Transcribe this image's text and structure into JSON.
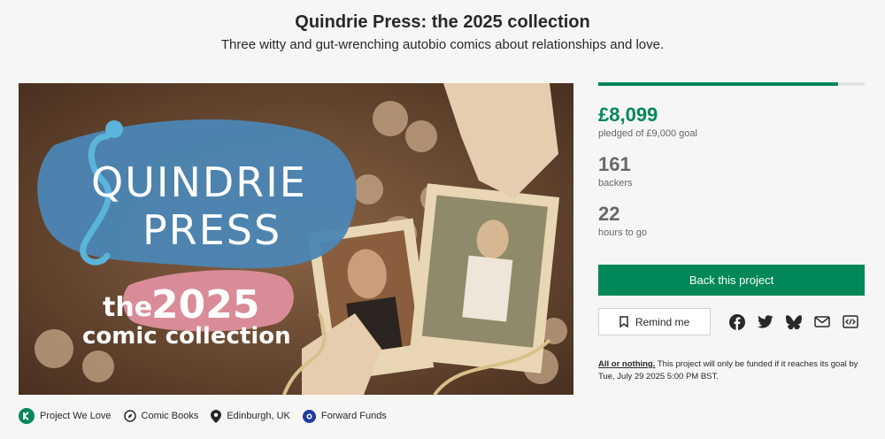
{
  "header": {
    "title": "Quindrie Press: the 2025 collection",
    "subtitle": "Three witty and gut-wrenching autobio comics about relationships and love."
  },
  "hero": {
    "logo_line1": "QUINDRIE",
    "logo_line2": "PRESS",
    "tagline_the": "the",
    "tagline_year": "2025",
    "tagline_rest": "comic collection"
  },
  "campaign": {
    "progress_fraction": 0.9,
    "pledged_amount": "£8,099",
    "pledged_label": "pledged of £9,000 goal",
    "backers_count": "161",
    "backers_label": "backers",
    "hours_count": "22",
    "hours_label": "hours to go",
    "back_button": "Back this project",
    "remind_button": "Remind me",
    "note_bold": "All or nothing.",
    "note_text": " This project will only be funded if it reaches its goal by Tue, July 29 2025 5:00 PM BST."
  },
  "social_icons": [
    "facebook-icon",
    "twitter-icon",
    "bluesky-icon",
    "email-icon",
    "embed-icon"
  ],
  "tags": [
    {
      "label": "Project We Love",
      "icon": "kickstarter-badge-icon"
    },
    {
      "label": "Comic Books",
      "icon": "compass-icon"
    },
    {
      "label": "Edinburgh, UK",
      "icon": "location-pin-icon"
    },
    {
      "label": "Forward Funds",
      "icon": "forward-funds-icon"
    }
  ],
  "colors": {
    "brand_green": "#028858",
    "logo_blue": "#4b86b4",
    "logo_pink": "#d98c98"
  }
}
